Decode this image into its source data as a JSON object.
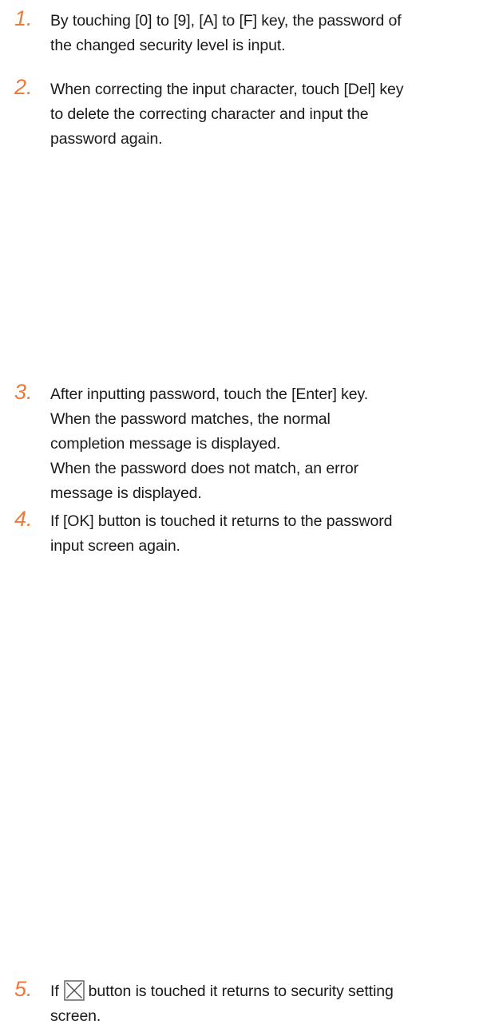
{
  "steps": [
    {
      "number": "1.",
      "lines": [
        "By touching [0] to [9], [A] to [F] key, the password of",
        "the changed security level is input."
      ]
    },
    {
      "number": "2.",
      "lines": [
        "When correcting the input character, touch [Del] key",
        "to delete the correcting character and input the",
        "password again."
      ]
    },
    {
      "number": "3.",
      "lines": [
        "After inputting password, touch the [Enter] key.",
        "When the password matches, the normal",
        "completion message is displayed.",
        "When the password does not match, an error",
        "message is displayed."
      ]
    },
    {
      "number": "4.",
      "lines": [
        "If [OK] button is touched it returns to the password",
        "input screen again."
      ]
    },
    {
      "number": "5.",
      "before_icon": "If",
      "icon": "close-box-icon",
      "after_icon": "button is touched it returns to security setting",
      "line2": "screen."
    }
  ],
  "colors": {
    "step_number": "#ea7b3a",
    "text": "#1a1a1a",
    "icon_stroke": "#4d4d4d"
  }
}
